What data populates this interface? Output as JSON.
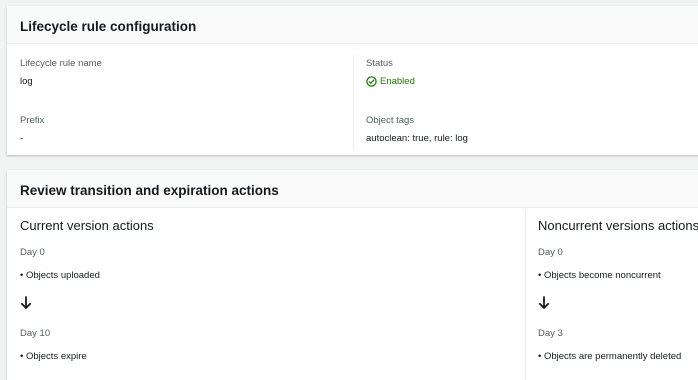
{
  "config": {
    "title": "Lifecycle rule configuration",
    "rule_name_label": "Lifecycle rule name",
    "rule_name_value": "log",
    "status_label": "Status",
    "status_value": "Enabled",
    "prefix_label": "Prefix",
    "prefix_value": "-",
    "tags_label": "Object tags",
    "tags_value": "autoclean: true, rule: log"
  },
  "review": {
    "title": "Review transition and expiration actions",
    "current": {
      "title": "Current version actions",
      "steps": [
        {
          "day": "Day 0",
          "action": "Objects uploaded"
        },
        {
          "day": "Day 10",
          "action": "Objects expire"
        }
      ]
    },
    "noncurrent": {
      "title": "Noncurrent versions actions",
      "steps": [
        {
          "day": "Day 0",
          "action": "Objects become noncurrent"
        },
        {
          "day": "Day 3",
          "action": "Objects are permanently deleted"
        }
      ]
    }
  },
  "colors": {
    "status_green": "#1d8102",
    "label_grey": "#545b64",
    "text": "#16191f"
  },
  "icons": {
    "status": "check-circle-icon",
    "flow": "arrow-down-icon"
  }
}
